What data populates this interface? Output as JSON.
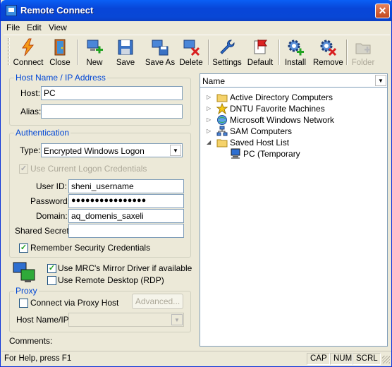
{
  "window": {
    "title": "Remote Connect",
    "close_glyph": "✕"
  },
  "menu": [
    "File",
    "Edit",
    "View"
  ],
  "toolbar": {
    "connect": "Connect",
    "close": "Close",
    "new": "New",
    "save": "Save",
    "save_as": "Save As",
    "delete": "Delete",
    "settings": "Settings",
    "default": "Default",
    "install": "Install",
    "remove": "Remove",
    "folder": "Folder"
  },
  "host": {
    "group_label": "Host Name / IP Address",
    "host_label": "Host:",
    "host_value": "PC",
    "alias_label": "Alias:",
    "alias_value": ""
  },
  "auth": {
    "group_label": "Authentication",
    "type_label": "Type:",
    "type_value": "Encrypted Windows Logon",
    "use_current_label": "Use Current Logon Credentials",
    "userid_label": "User ID:",
    "userid_value": "sheni_username",
    "password_label": "Password:",
    "password_value": "●●●●●●●●●●●●●●●●",
    "domain_label": "Domain:",
    "domain_value": "aq_domenis_saxeli",
    "secret_label": "Shared Secret:",
    "secret_value": "",
    "remember_label": "Remember Security Credentials"
  },
  "options": {
    "mirror_label": "Use MRC's Mirror Driver if available",
    "rdp_label": "Use Remote Desktop (RDP)"
  },
  "proxy": {
    "group_label": "Proxy",
    "via_label": "Connect via Proxy Host",
    "advanced_label": "Advanced...",
    "hostname_label": "Host Name/IP:",
    "hostname_value": ""
  },
  "comments_label": "Comments:",
  "tree": {
    "sort_value": "Name",
    "nodes": [
      "Active Directory Computers",
      "DNTU Favorite Machines",
      "Microsoft Windows Network",
      "SAM Computers",
      "Saved Host List",
      "PC (Temporary"
    ]
  },
  "status": {
    "help": "For Help, press F1",
    "cap": "CAP",
    "num": "NUM",
    "scrl": "SCRL"
  },
  "colors": {
    "title_bar": "#0846d8",
    "group_label": "#0046d5",
    "window_bg": "#ece9d8"
  }
}
